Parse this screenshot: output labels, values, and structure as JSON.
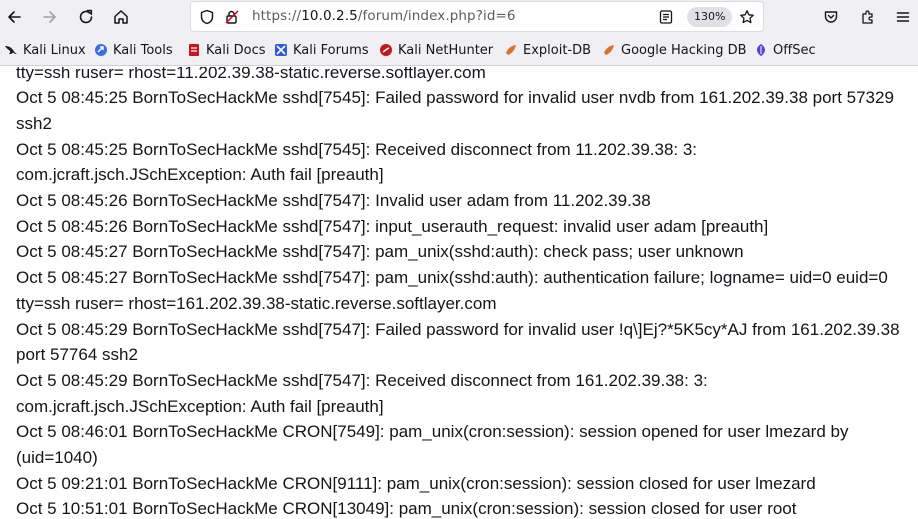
{
  "browser": {
    "url_scheme": "https://",
    "url_host": "10.0.2.5",
    "url_path": "/forum/index.php?id=6",
    "zoom": "130%"
  },
  "bookmarks": [
    {
      "label": "Kali Linux",
      "icon": "kali-dragon-icon"
    },
    {
      "label": "Kali Tools",
      "icon": "kali-tools-icon"
    },
    {
      "label": "Kali Docs",
      "icon": "kali-docs-icon"
    },
    {
      "label": "Kali Forums",
      "icon": "kali-forums-icon"
    },
    {
      "label": "Kali NetHunter",
      "icon": "kali-nethunter-icon"
    },
    {
      "label": "Exploit-DB",
      "icon": "exploit-db-icon"
    },
    {
      "label": "Google Hacking DB",
      "icon": "ghdb-icon"
    },
    {
      "label": "OffSec",
      "icon": "offsec-icon"
    }
  ],
  "log_lines": [
    "tty=ssh ruser= rhost=11.202.39.38-static.reverse.softlayer.com",
    "Oct 5 08:45:25 BornToSecHackMe sshd[7545]: Failed password for invalid user nvdb from 161.202.39.38 port 57329 ssh2",
    "Oct 5 08:45:25 BornToSecHackMe sshd[7545]: Received disconnect from 11.202.39.38: 3: com.jcraft.jsch.JSchException: Auth fail [preauth]",
    "Oct 5 08:45:26 BornToSecHackMe sshd[7547]: Invalid user adam from 11.202.39.38",
    "Oct 5 08:45:26 BornToSecHackMe sshd[7547]: input_userauth_request: invalid user adam [preauth]",
    "Oct 5 08:45:27 BornToSecHackMe sshd[7547]: pam_unix(sshd:auth): check pass; user unknown",
    "Oct 5 08:45:27 BornToSecHackMe sshd[7547]: pam_unix(sshd:auth): authentication failure; logname= uid=0 euid=0 tty=ssh ruser= rhost=161.202.39.38-static.reverse.softlayer.com",
    "Oct 5 08:45:29 BornToSecHackMe sshd[7547]: Failed password for invalid user !q\\]Ej?*5K5cy*AJ from 161.202.39.38 port 57764 ssh2",
    "Oct 5 08:45:29 BornToSecHackMe sshd[7547]: Received disconnect from 161.202.39.38: 3: com.jcraft.jsch.JSchException: Auth fail [preauth]",
    "Oct 5 08:46:01 BornToSecHackMe CRON[7549]: pam_unix(cron:session): session opened for user lmezard by (uid=1040)",
    "Oct 5 09:21:01 BornToSecHackMe CRON[9111]: pam_unix(cron:session): session closed for user lmezard",
    "Oct 5 10:51:01 BornToSecHackMe CRON[13049]: pam_unix(cron:session): session closed for user root"
  ]
}
